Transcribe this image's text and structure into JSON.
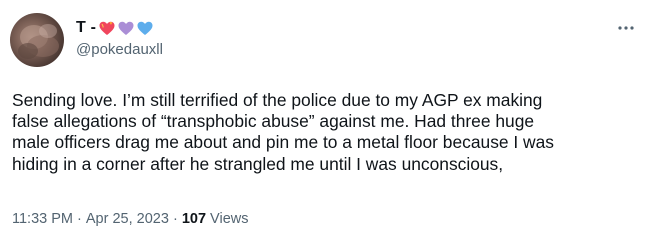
{
  "tweet": {
    "author": {
      "display_name": "T -",
      "emojis": [
        "heart-on-fire-icon",
        "purple-heart-icon",
        "blue-heart-icon"
      ],
      "handle": "@pokedauxll"
    },
    "text": "Sending love. I’m still terrified of the police due to my AGP ex making\nfalse allegations of “transphobic abuse” against me. Had three huge\nmale officers drag me about and pin me to a metal floor because I was\nhiding in a corner after he strangled me until I was unconscious,",
    "meta": {
      "time": "11:33 PM",
      "separator1": " · ",
      "date": "Apr 25, 2023",
      "separator2": " · ",
      "views_count": "107",
      "views_label": " Views"
    },
    "more_icon": "more-horizontal-icon"
  },
  "colors": {
    "text_primary": "#0f1419",
    "text_secondary": "#536471",
    "heart_red": "#f0455d",
    "heart_purple": "#aa8ed6",
    "heart_blue": "#5dadec"
  }
}
